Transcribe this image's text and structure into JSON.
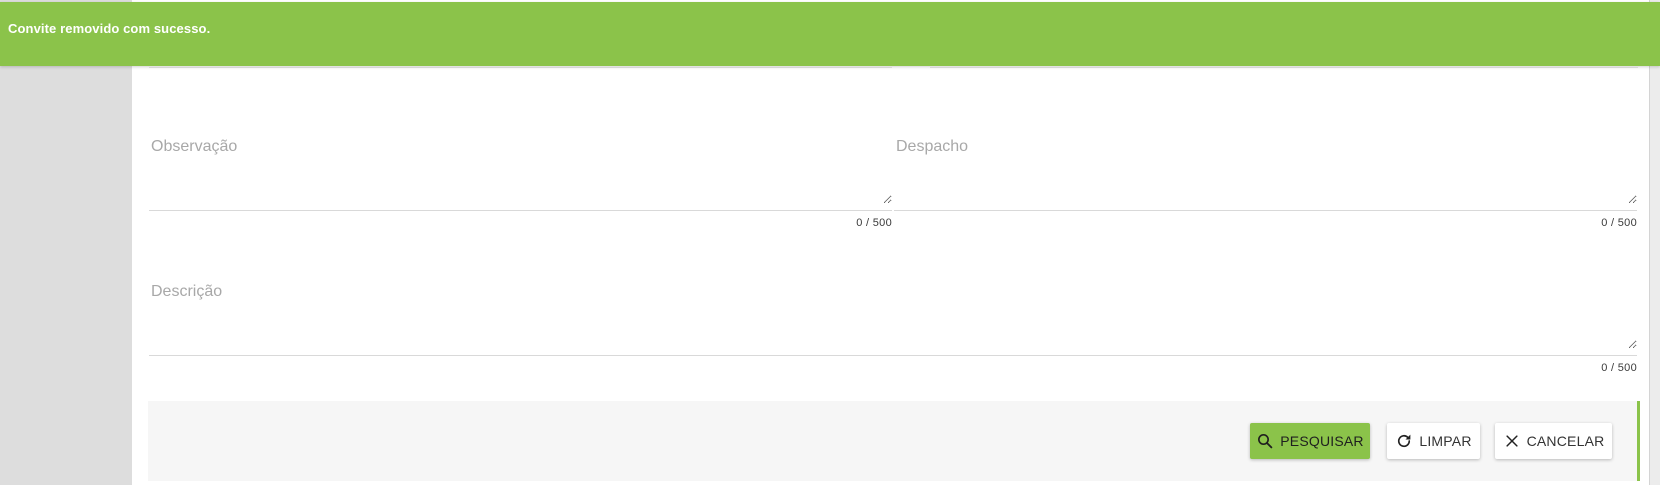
{
  "toast": {
    "message": "Convite removido com sucesso."
  },
  "form": {
    "observacao": {
      "label": "Observação",
      "value": "",
      "counter": "0 / 500"
    },
    "despacho": {
      "label": "Despacho",
      "value": "",
      "counter": "0 / 500"
    },
    "descricao": {
      "label": "Descrição",
      "value": "",
      "counter": "0 / 500"
    }
  },
  "actions": {
    "pesquisar": {
      "label": "PESQUISAR",
      "icon": "search-icon"
    },
    "limpar": {
      "label": "LIMPAR",
      "icon": "refresh-icon"
    },
    "cancelar": {
      "label": "CANCELAR",
      "icon": "close-icon"
    }
  },
  "colors": {
    "accent": "#8bc34a",
    "toast_text": "#ffffff",
    "sidebar": "#dddddd",
    "action_bar": "#f6f6f6"
  }
}
